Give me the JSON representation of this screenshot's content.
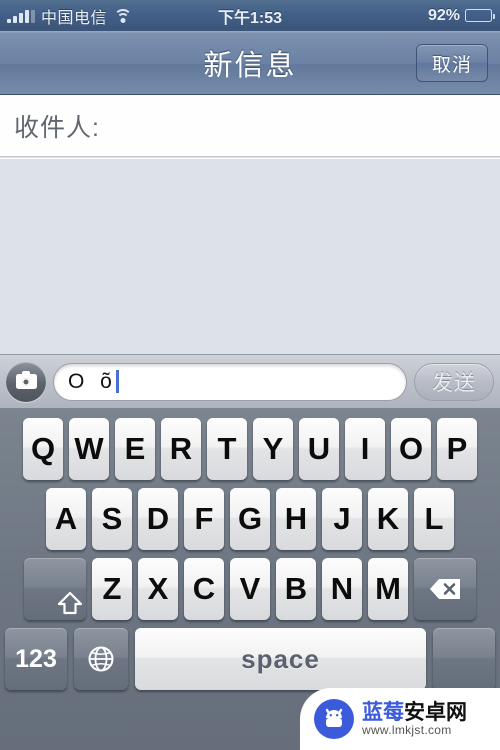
{
  "status_bar": {
    "signal_icon": "signal-bars-icon",
    "carrier": "中国电信",
    "wifi_icon": "wifi-icon",
    "time": "下午1:53",
    "battery_percent": "92%",
    "battery_icon": "battery-icon",
    "battery_level": 92
  },
  "nav_bar": {
    "title": "新信息",
    "cancel_label": "取消"
  },
  "recipient": {
    "label": "收件人:",
    "value": "",
    "placeholder": ""
  },
  "input_bar": {
    "camera_icon": "camera-icon",
    "text_value": "O õ",
    "send_label": "发送",
    "send_enabled": false
  },
  "keyboard": {
    "row1": [
      "Q",
      "W",
      "E",
      "R",
      "T",
      "Y",
      "U",
      "I",
      "O",
      "P"
    ],
    "row2": [
      "A",
      "S",
      "D",
      "F",
      "G",
      "H",
      "J",
      "K",
      "L"
    ],
    "row3": [
      "Z",
      "X",
      "C",
      "V",
      "B",
      "N",
      "M"
    ],
    "shift_icon": "shift-icon",
    "delete_icon": "backspace-icon",
    "numbers_label": "123",
    "globe_icon": "globe-icon",
    "space_label": "space"
  },
  "watermark": {
    "logo_icon": "android-robot-icon",
    "title_part1": "蓝莓",
    "title_part2": "安卓网",
    "url": "www.lmkjst.com"
  },
  "colors": {
    "status_bar": "#44618a",
    "nav_bar": "#6b82a4",
    "body_bg": "#dde1e9",
    "keyboard_bg": "#6d7682",
    "caret": "#4a6fd4",
    "watermark_blue": "#3b5bdb"
  }
}
